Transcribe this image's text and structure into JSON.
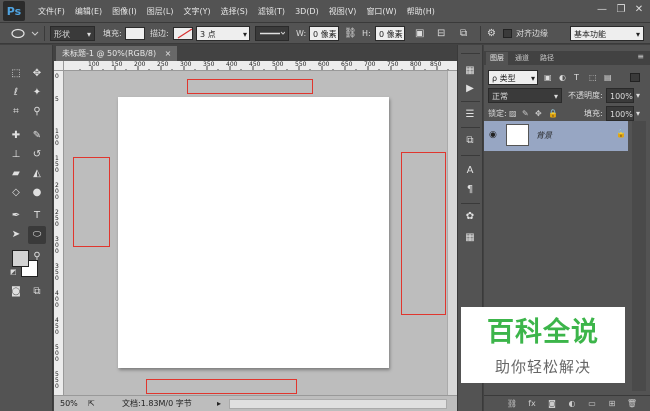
{
  "app": {
    "logo": "Ps"
  },
  "menu": [
    "文件(F)",
    "编辑(E)",
    "图像(I)",
    "图层(L)",
    "文字(Y)",
    "选择(S)",
    "滤镜(T)",
    "3D(D)",
    "视图(V)",
    "窗口(W)",
    "帮助(H)"
  ],
  "window_controls": {
    "minimize": "—",
    "restore": "❐",
    "close": "✕"
  },
  "options": {
    "mode": "形状",
    "fill_label": "填充:",
    "stroke_label": "描边:",
    "stroke_width": "3 点",
    "w_label": "W:",
    "w_value": "0 像素",
    "h_label": "H:",
    "h_value": "0 像素",
    "align_edges_label": "对齐边缘",
    "workspace": "基本功能"
  },
  "document": {
    "tab_title": "未标题-1 @ 50%(RGB/8)",
    "tab_close": "×",
    "ruler_h_labels": [
      "100",
      "150",
      "200",
      "250",
      "300",
      "350",
      "400",
      "450",
      "500",
      "550",
      "600",
      "650",
      "700",
      "750",
      "800",
      "850",
      "900"
    ],
    "ruler_v_labels": [
      "0",
      "5",
      "1 0 0",
      "1 5 0",
      "2 0 0",
      "2 5 0",
      "3 0 0",
      "3 5 0",
      "4 0 0",
      "4 5 0",
      "5 0 0",
      "5 5 0"
    ],
    "zoom": "50%",
    "doc_info": "文档:1.83M/0 字节"
  },
  "layers_panel": {
    "tabs": [
      "图层",
      "通道",
      "路径"
    ],
    "filter_kind": "ρ 类型",
    "blend_mode": "正常",
    "opacity_label": "不透明度:",
    "opacity_value": "100%",
    "lock_label": "锁定:",
    "fill_label": "填充:",
    "fill_value": "100%",
    "layers": [
      {
        "name": "背景",
        "visible": true,
        "locked": true
      }
    ]
  },
  "watermark": {
    "title": "百科全说",
    "subtitle": "助你轻松解决"
  },
  "colors": {
    "ui_gray": "#535353",
    "canvas_bg": "#bdbdbd",
    "highlight_red": "#e0362e",
    "selected_layer": "#97a6c3",
    "watermark_green": "#3cb54a"
  }
}
